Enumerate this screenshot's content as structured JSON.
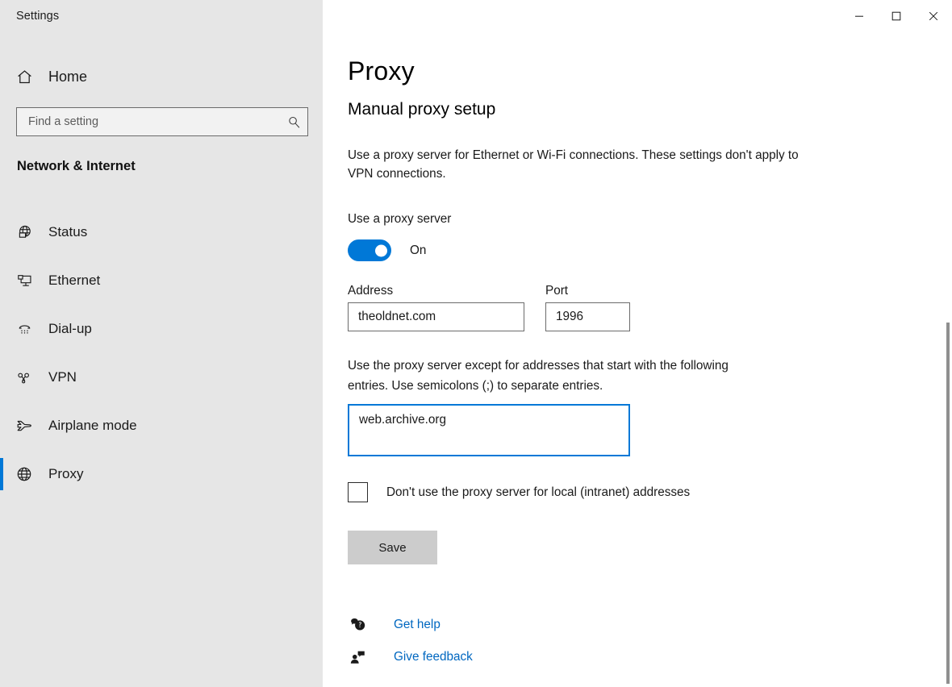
{
  "window": {
    "title": "Settings",
    "controls": [
      {
        "name": "minimize",
        "glyph": "minimize-icon"
      },
      {
        "name": "maximize",
        "glyph": "maximize-icon"
      },
      {
        "name": "close",
        "glyph": "close-icon"
      }
    ]
  },
  "sidebar": {
    "home_label": "Home",
    "home_icon": "home-icon",
    "search": {
      "placeholder": "Find a setting",
      "value": "",
      "icon": "search-icon"
    },
    "section_title": "Network & Internet",
    "items": [
      {
        "label": "Status",
        "icon": "globe-status-icon",
        "selected": false
      },
      {
        "label": "Ethernet",
        "icon": "ethernet-monitor-icon",
        "selected": false
      },
      {
        "label": "Dial-up",
        "icon": "dialup-phone-icon",
        "selected": false
      },
      {
        "label": "VPN",
        "icon": "vpn-key-icon",
        "selected": false
      },
      {
        "label": "Airplane mode",
        "icon": "airplane-icon",
        "selected": false
      },
      {
        "label": "Proxy",
        "icon": "globe-proxy-icon",
        "selected": true
      }
    ]
  },
  "main": {
    "page_title": "Proxy",
    "section_heading": "Manual proxy setup",
    "description": "Use a proxy server for Ethernet or Wi-Fi connections. These settings don't apply to VPN connections.",
    "use_proxy_label": "Use a proxy server",
    "toggle_state": "On",
    "toggle_on": true,
    "address_label": "Address",
    "address_value": "theoldnet.com",
    "port_label": "Port",
    "port_value": "1996",
    "exceptions_description": "Use the proxy server except for addresses that start with the following entries. Use semicolons (;) to separate entries.",
    "exceptions_value": "web.archive.org",
    "local_bypass_label": "Don't use the proxy server for local (intranet) addresses",
    "local_bypass_checked": false,
    "save_label": "Save",
    "get_help_label": "Get help",
    "give_feedback_label": "Give feedback"
  },
  "colors": {
    "accent": "#0078d7",
    "link": "#0067c0",
    "sidebar_bg": "#e6e6e6",
    "button_bg": "#cccccc"
  }
}
